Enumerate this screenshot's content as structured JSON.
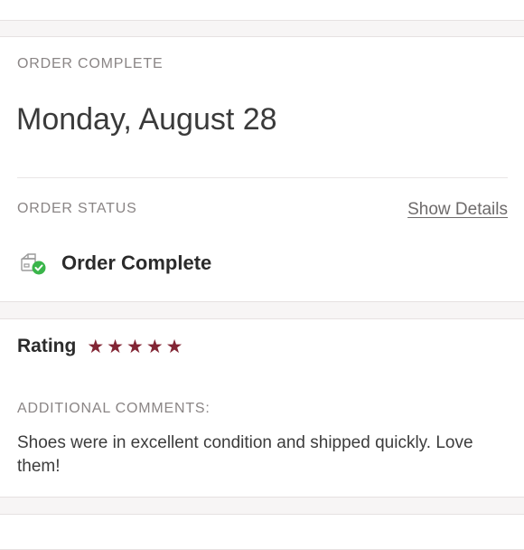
{
  "order": {
    "section_label": "ORDER COMPLETE",
    "date": "Monday, August 28",
    "status_label": "ORDER STATUS",
    "show_details": "Show Details",
    "status_text": "Order Complete",
    "status_icon": "package-check-icon",
    "status_icon_color": "#3ab54a"
  },
  "review": {
    "rating_label": "Rating",
    "stars": 5,
    "star_glyph": "★",
    "star_color": "#822534",
    "comments_label": "ADDITIONAL COMMENTS:",
    "comments": "Shoes were in excellent condition and shipped quickly. Love them!"
  }
}
